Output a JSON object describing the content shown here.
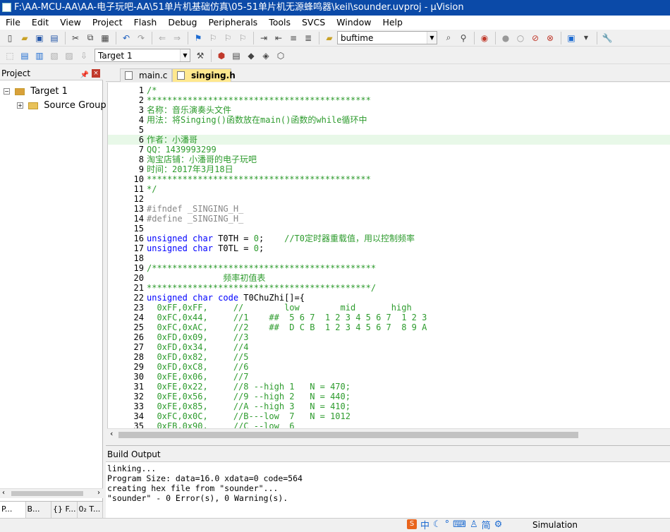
{
  "window": {
    "title": "F:\\AA-MCU-AA\\AA-电子玩吧-AA\\51单片机基础仿真\\05-51单片机无源蜂鸣器\\keil\\sounder.uvproj - µVision"
  },
  "menu": [
    "File",
    "Edit",
    "View",
    "Project",
    "Flash",
    "Debug",
    "Peripherals",
    "Tools",
    "SVCS",
    "Window",
    "Help"
  ],
  "toolbar": {
    "find_value": "buftime",
    "target_value": "Target 1"
  },
  "project": {
    "header": "Project",
    "root": "Target 1",
    "group": "Source Group",
    "tabs": [
      "P...",
      "B...",
      "{} F...",
      "0₂ T..."
    ]
  },
  "tabs": [
    {
      "label": "main.c"
    },
    {
      "label": "singing.h"
    }
  ],
  "code_lines": [
    {
      "n": "1",
      "t": "/*",
      "c": "cm"
    },
    {
      "n": "2",
      "t": "********************************************",
      "c": "cm"
    },
    {
      "n": "3",
      "t": "名称：音乐演奏头文件",
      "c": "cm"
    },
    {
      "n": "4",
      "t": "用法：将Singing()函数放在main()函数的while循环中",
      "c": "cm"
    },
    {
      "n": "5",
      "t": "",
      "c": "cm"
    },
    {
      "n": "6",
      "t": "作者：小潘哥",
      "c": "cm"
    },
    {
      "n": "7",
      "t": "QQ：1439993299",
      "c": "cm"
    },
    {
      "n": "8",
      "t": "淘宝店铺：小潘哥的电子玩吧",
      "c": "cm"
    },
    {
      "n": "9",
      "t": "时间：2017年3月18日",
      "c": "cm"
    },
    {
      "n": "10",
      "t": "********************************************",
      "c": "cm"
    },
    {
      "n": "11",
      "t": "*/",
      "c": "cm"
    },
    {
      "n": "12",
      "t": "",
      "c": "df"
    },
    {
      "n": "13",
      "t": "#ifndef _SINGING_H_",
      "c": "pp"
    },
    {
      "n": "14",
      "t": "#define _SINGING_H_",
      "c": "pp"
    },
    {
      "n": "15",
      "t": "",
      "c": "df"
    },
    {
      "n": "16",
      "t": "unsigned char T0TH = 0;    //T0定时器重载值，用以控制频率",
      "c": "mix1"
    },
    {
      "n": "17",
      "t": "unsigned char T0TL = 0;",
      "c": "mix2"
    },
    {
      "n": "18",
      "t": "",
      "c": "df"
    },
    {
      "n": "19",
      "t": "/********************************************",
      "c": "cm"
    },
    {
      "n": "20",
      "t": "               频率初值表",
      "c": "cm"
    },
    {
      "n": "21",
      "t": "********************************************/",
      "c": "cm"
    },
    {
      "n": "22",
      "t": "unsigned char code T0ChuZhi[]={",
      "c": "mix3"
    },
    {
      "n": "23",
      "t": "  0xFF,0xFF,     //        low        mid       high",
      "c": "cm"
    },
    {
      "n": "24",
      "t": "  0xFC,0x44,     //1    ##  5 6 7  1 2 3 4 5 6 7  1 2 3",
      "c": "cm"
    },
    {
      "n": "25",
      "t": "  0xFC,0xAC,     //2    ##  D C B  1 2 3 4 5 6 7  8 9 A",
      "c": "cm"
    },
    {
      "n": "26",
      "t": "  0xFD,0x09,     //3",
      "c": "cm"
    },
    {
      "n": "27",
      "t": "  0xFD,0x34,     //4",
      "c": "cm"
    },
    {
      "n": "28",
      "t": "  0xFD,0x82,     //5",
      "c": "cm"
    },
    {
      "n": "29",
      "t": "  0xFD,0xC8,     //6",
      "c": "cm"
    },
    {
      "n": "30",
      "t": "  0xFE,0x06,     //7",
      "c": "cm"
    },
    {
      "n": "31",
      "t": "  0xFE,0x22,     //8 --high 1   N = 470;",
      "c": "cm"
    },
    {
      "n": "32",
      "t": "  0xFE,0x56,     //9 --high 2   N = 440;",
      "c": "cm"
    },
    {
      "n": "33",
      "t": "  0xFE,0x85,     //A --high 3   N = 410;",
      "c": "cm"
    },
    {
      "n": "34",
      "t": "  0xFC,0x0C,     //B---low  7   N = 1012",
      "c": "cm"
    },
    {
      "n": "35",
      "t": "  0xFB,0x90,     //C --low  6",
      "c": "cm"
    }
  ],
  "build": {
    "header": "Build Output",
    "lines": [
      "linking...",
      "Program Size: data=16.0 xdata=0 code=564",
      "creating hex file from \"sounder\"...",
      "\"sounder\" - 0 Error(s), 0 Warning(s)."
    ]
  },
  "status": {
    "mode": "Simulation"
  },
  "ime": {
    "label": "中",
    "simp": "简"
  }
}
